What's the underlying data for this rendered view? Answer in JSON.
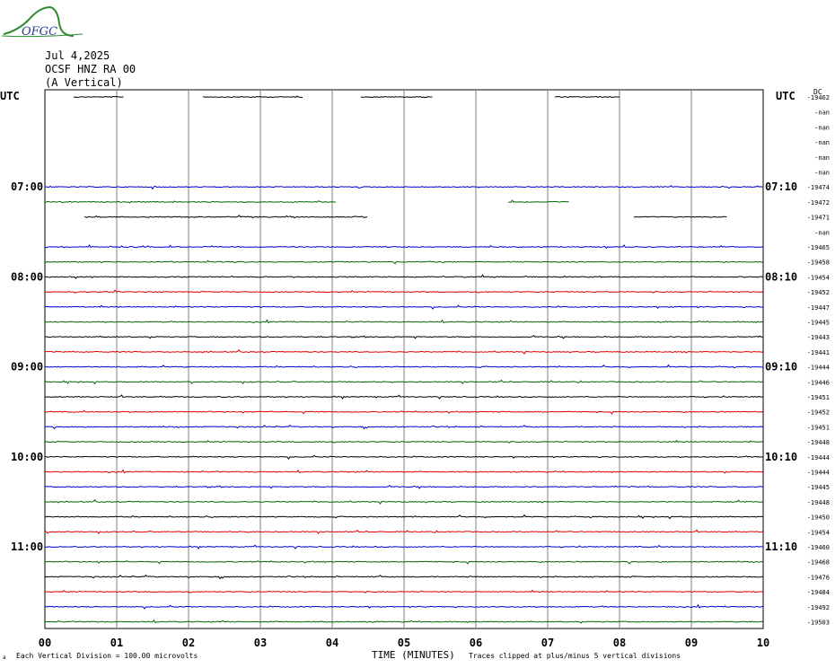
{
  "header": {
    "logo_text": "OFGC",
    "date": "Jul 4,2025",
    "station": "OCSF HNZ RA 00",
    "component": "(A Vertical)",
    "left_axis_label": "UTC",
    "right_axis_label": "UTC",
    "dc_label": "DC"
  },
  "footer": {
    "scale_note": "Each Vertical Division =  100.00 microvolts",
    "xlabel": "TIME (MINUTES)",
    "clip_note": "Traces clipped at plus/minus 5 vertical divisions",
    "corner_mark": "a"
  },
  "colors": {
    "black": "#000000",
    "red": "#dd0000",
    "blue": "#0000cc",
    "green": "#006600",
    "grid": "#808080"
  },
  "chart_data": {
    "type": "line",
    "title": "OCSF HNZ RA 00 (A Vertical)",
    "xlabel": "TIME (MINUTES)",
    "xlim": [
      0,
      10
    ],
    "x_ticks": [
      "00",
      "01",
      "02",
      "03",
      "04",
      "05",
      "06",
      "07",
      "08",
      "09",
      "10"
    ],
    "grid": true,
    "left_time_labels": [
      {
        "row": 6,
        "text": "07:00"
      },
      {
        "row": 12,
        "text": "08:00"
      },
      {
        "row": 18,
        "text": "09:00"
      },
      {
        "row": 24,
        "text": "10:00"
      },
      {
        "row": 30,
        "text": "11:00"
      }
    ],
    "right_time_labels": [
      {
        "row": 6,
        "text": "07:10"
      },
      {
        "row": 12,
        "text": "08:10"
      },
      {
        "row": 18,
        "text": "09:10"
      },
      {
        "row": 24,
        "text": "10:10"
      },
      {
        "row": 30,
        "text": "11:10"
      }
    ],
    "traces": [
      {
        "dc": "-19462",
        "color": "black",
        "segments": [
          [
            0.4,
            1.1
          ],
          [
            2.2,
            3.6
          ],
          [
            4.4,
            5.4
          ],
          [
            7.1,
            8.0
          ]
        ]
      },
      {
        "dc": "-nan",
        "color": "red",
        "segments": []
      },
      {
        "dc": "-nan",
        "color": "blue",
        "segments": []
      },
      {
        "dc": "-nan",
        "color": "green",
        "segments": []
      },
      {
        "dc": "-nan",
        "color": "black",
        "segments": []
      },
      {
        "dc": "-nan",
        "color": "red",
        "segments": []
      },
      {
        "dc": "-19474",
        "color": "blue",
        "segments": [
          [
            0.0,
            10.0
          ]
        ]
      },
      {
        "dc": "-19472",
        "color": "green",
        "segments": [
          [
            0.0,
            4.05
          ],
          [
            6.45,
            7.3
          ]
        ]
      },
      {
        "dc": "-19471",
        "color": "black",
        "segments": [
          [
            0.55,
            4.5
          ],
          [
            8.2,
            9.5
          ]
        ]
      },
      {
        "dc": "-nan",
        "color": "red",
        "segments": []
      },
      {
        "dc": "-19465",
        "color": "blue",
        "segments": [
          [
            0.0,
            10.0
          ]
        ]
      },
      {
        "dc": "-19458",
        "color": "green",
        "segments": [
          [
            0.0,
            10.0
          ]
        ]
      },
      {
        "dc": "-19454",
        "color": "black",
        "segments": [
          [
            0.0,
            10.0
          ]
        ]
      },
      {
        "dc": "-19452",
        "color": "red",
        "segments": [
          [
            0.0,
            10.0
          ]
        ]
      },
      {
        "dc": "-19447",
        "color": "blue",
        "segments": [
          [
            0.0,
            10.0
          ]
        ]
      },
      {
        "dc": "-19445",
        "color": "green",
        "segments": [
          [
            0.0,
            10.0
          ]
        ]
      },
      {
        "dc": "-19443",
        "color": "black",
        "segments": [
          [
            0.0,
            10.0
          ]
        ]
      },
      {
        "dc": "-19441",
        "color": "red",
        "segments": [
          [
            0.0,
            10.0
          ]
        ]
      },
      {
        "dc": "-19444",
        "color": "blue",
        "segments": [
          [
            0.0,
            10.0
          ]
        ]
      },
      {
        "dc": "-19446",
        "color": "green",
        "segments": [
          [
            0.0,
            10.0
          ]
        ]
      },
      {
        "dc": "-19451",
        "color": "black",
        "segments": [
          [
            0.0,
            10.0
          ]
        ]
      },
      {
        "dc": "-19452",
        "color": "red",
        "segments": [
          [
            0.0,
            10.0
          ]
        ]
      },
      {
        "dc": "-19451",
        "color": "blue",
        "segments": [
          [
            0.0,
            10.0
          ]
        ]
      },
      {
        "dc": "-19448",
        "color": "green",
        "segments": [
          [
            0.0,
            10.0
          ]
        ]
      },
      {
        "dc": "-19444",
        "color": "black",
        "segments": [
          [
            0.0,
            10.0
          ]
        ]
      },
      {
        "dc": "-19444",
        "color": "red",
        "segments": [
          [
            0.0,
            10.0
          ]
        ]
      },
      {
        "dc": "-19445",
        "color": "blue",
        "segments": [
          [
            0.0,
            10.0
          ]
        ]
      },
      {
        "dc": "-19448",
        "color": "green",
        "segments": [
          [
            0.0,
            10.0
          ]
        ]
      },
      {
        "dc": "-19450",
        "color": "black",
        "segments": [
          [
            0.0,
            10.0
          ]
        ]
      },
      {
        "dc": "-19454",
        "color": "red",
        "segments": [
          [
            0.0,
            10.0
          ]
        ]
      },
      {
        "dc": "-19460",
        "color": "blue",
        "segments": [
          [
            0.0,
            10.0
          ]
        ]
      },
      {
        "dc": "-19468",
        "color": "green",
        "segments": [
          [
            0.0,
            10.0
          ]
        ]
      },
      {
        "dc": "-19476",
        "color": "black",
        "segments": [
          [
            0.0,
            10.0
          ]
        ]
      },
      {
        "dc": "-19484",
        "color": "red",
        "segments": [
          [
            0.0,
            10.0
          ]
        ]
      },
      {
        "dc": "-19492",
        "color": "blue",
        "segments": [
          [
            0.0,
            10.0
          ]
        ]
      },
      {
        "dc": "-19503",
        "color": "green",
        "segments": [
          [
            0.0,
            10.0
          ]
        ]
      }
    ]
  }
}
